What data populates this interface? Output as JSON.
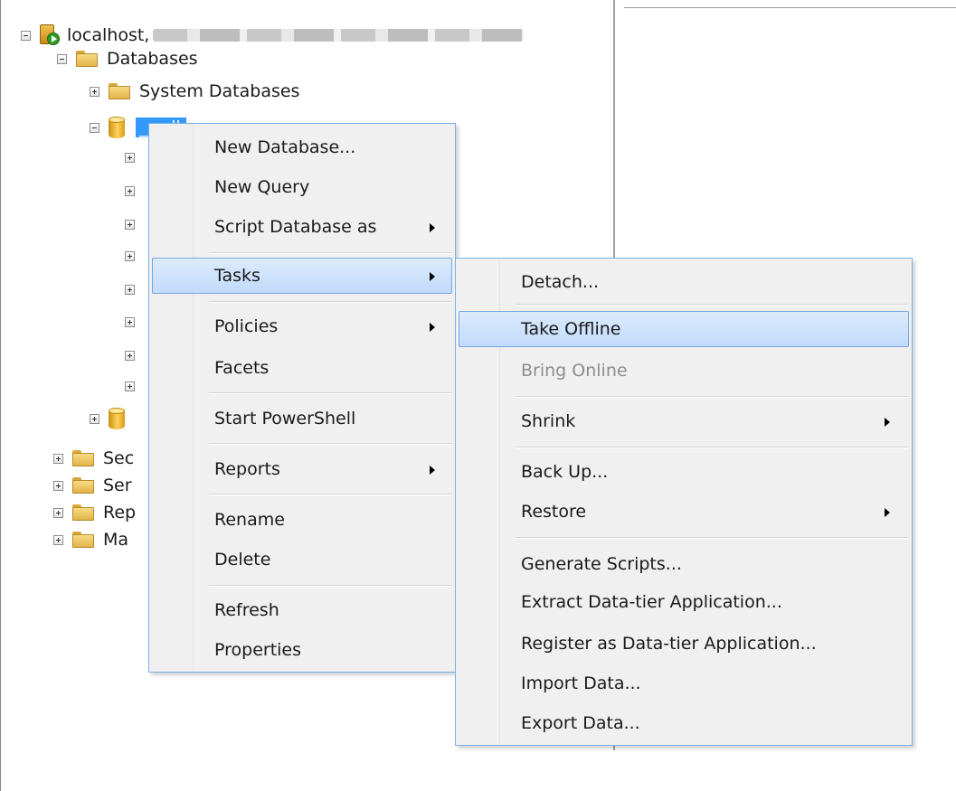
{
  "tree": {
    "server_label": "localhost,",
    "databases_label": "Databases",
    "system_databases_label": "System Databases",
    "selected_db_label": "___db",
    "security_label": "Sec",
    "server_objects_label": "Ser",
    "replication_label": "Rep",
    "management_label": "Ma"
  },
  "context_menu": {
    "items": {
      "new_database": "New Database...",
      "new_query": "New Query",
      "script_database_as": "Script Database as",
      "tasks": "Tasks",
      "policies": "Policies",
      "facets": "Facets",
      "start_powershell": "Start PowerShell",
      "reports": "Reports",
      "rename": "Rename",
      "delete": "Delete",
      "refresh": "Refresh",
      "properties": "Properties"
    },
    "highlighted": "Tasks"
  },
  "tasks_submenu": {
    "items": {
      "detach": "Detach...",
      "take_offline": "Take Offline",
      "bring_online": "Bring Online",
      "shrink": "Shrink",
      "back_up": "Back Up...",
      "restore": "Restore",
      "generate_scripts": "Generate Scripts...",
      "extract_data_tier": "Extract Data-tier Application...",
      "register_data_tier": "Register as Data-tier Application...",
      "import_data": "Import Data...",
      "export_data": "Export Data..."
    },
    "highlighted": "Take Offline",
    "disabled": [
      "Bring Online"
    ]
  },
  "colors": {
    "selection": "#3399ff",
    "menu_highlight": "#c1dbfc",
    "menu_border": "#7ab0e8"
  }
}
